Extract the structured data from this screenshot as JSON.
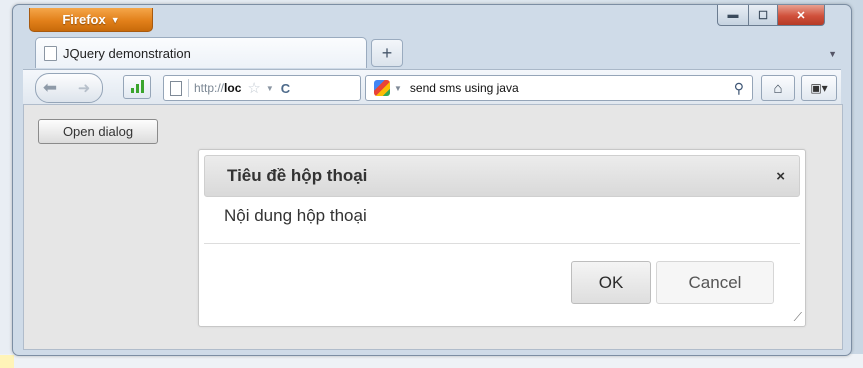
{
  "browser": {
    "menu_button": "Firefox",
    "window_controls": {
      "minimize": "▬",
      "maximize": "☐",
      "close": "✕"
    },
    "tab": {
      "title": "JQuery demonstration"
    },
    "new_tab_label": "+",
    "url": {
      "scheme": "http://",
      "host": "loc"
    },
    "search": {
      "engine_icon": "google-icon",
      "query": "send sms using java"
    },
    "icons": {
      "back": "back-arrow-icon",
      "forward": "forward-arrow-icon",
      "signal": "signal-bars-icon",
      "page": "page-icon",
      "bookmark_star": "star-icon",
      "reload": "reload-icon",
      "search": "magnifier-icon",
      "home": "home-icon",
      "bookmarks": "bookmarks-icon"
    }
  },
  "page": {
    "open_dialog_label": "Open dialog"
  },
  "dialog": {
    "title": "Tiêu đề hộp thoại",
    "close_glyph": "×",
    "body": "Nội dung hộp thoại",
    "ok_label": "OK",
    "cancel_label": "Cancel"
  },
  "colors": {
    "firefox_orange": "#e2801a",
    "dialog_titlebar": "#d9d9d9",
    "page_background": "#e6e6e6"
  }
}
